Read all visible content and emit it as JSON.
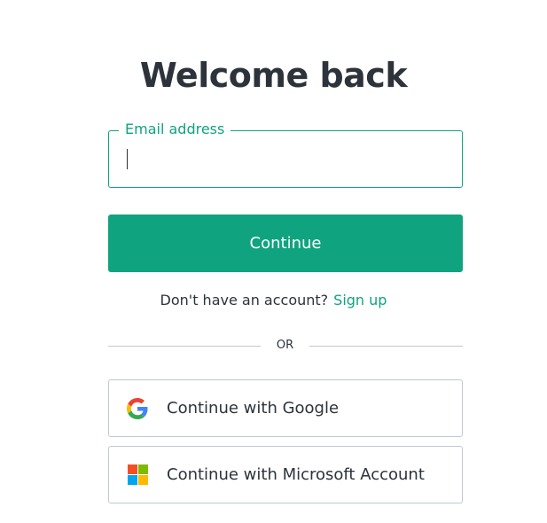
{
  "login": {
    "title": "Welcome back",
    "email_field": {
      "label": "Email address",
      "value": ""
    },
    "continue_label": "Continue",
    "signup_prompt": "Don't have an account?",
    "signup_link": "Sign up",
    "divider_text": "OR",
    "google_label": "Continue with Google",
    "microsoft_label": "Continue with Microsoft Account",
    "icons": {
      "google": "google-logo-icon",
      "microsoft": "microsoft-logo-icon"
    }
  },
  "colors": {
    "accent": "#10a37f",
    "text": "#2d333a",
    "border": "#c2c8d0",
    "google_blue": "#4285f4",
    "google_red": "#ea4335",
    "google_yellow": "#fbbc05",
    "google_green": "#34a853",
    "ms_red": "#f25022",
    "ms_green": "#7fba00",
    "ms_blue": "#00a4ef",
    "ms_yellow": "#ffb900"
  }
}
